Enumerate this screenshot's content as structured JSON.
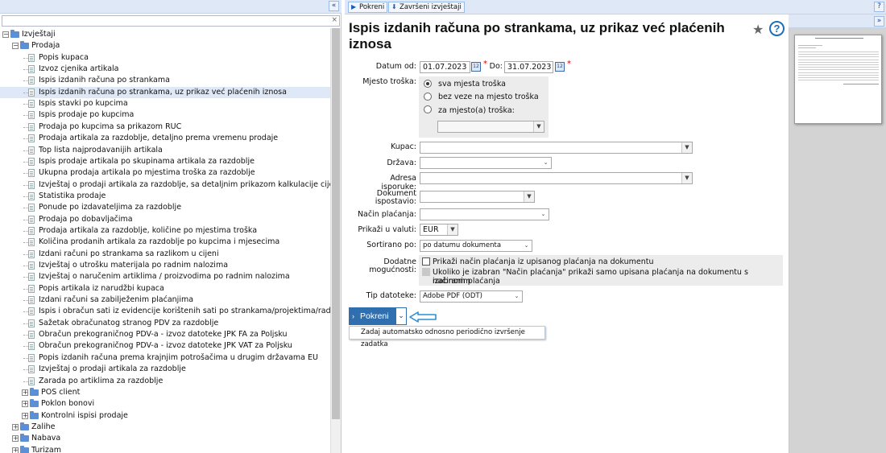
{
  "left_panel": {
    "collapse_label": "«",
    "search_placeholder": "",
    "clear_label": "×",
    "tree": [
      {
        "level": 0,
        "kind": "folder",
        "expanded": true,
        "label": "Izvještaji"
      },
      {
        "level": 1,
        "kind": "folder",
        "expanded": true,
        "label": "Prodaja"
      },
      {
        "level": 2,
        "kind": "doc",
        "label": "Popis kupaca"
      },
      {
        "level": 2,
        "kind": "doc",
        "label": "Izvoz cjenika artikala"
      },
      {
        "level": 2,
        "kind": "doc",
        "label": "Ispis izdanih računa po strankama"
      },
      {
        "level": 2,
        "kind": "doc",
        "label": "Ispis izdanih računa po strankama, uz prikaz već plaćenih iznosa",
        "selected": true
      },
      {
        "level": 2,
        "kind": "doc",
        "label": "Ispis stavki po kupcima"
      },
      {
        "level": 2,
        "kind": "doc",
        "label": "Ispis prodaje po kupcima"
      },
      {
        "level": 2,
        "kind": "doc",
        "label": "Prodaja po kupcima sa prikazom RUC"
      },
      {
        "level": 2,
        "kind": "doc",
        "label": "Prodaja artikala za razdoblje, detaljno prema vremenu prodaje"
      },
      {
        "level": 2,
        "kind": "doc",
        "label": "Top lista najprodavanijih artikala"
      },
      {
        "level": 2,
        "kind": "doc",
        "label": "Ispis prodaje artikala po skupinama artikala za razdoblje"
      },
      {
        "level": 2,
        "kind": "doc",
        "label": "Ukupna prodaja artikala po mjestima troška za razdoblje"
      },
      {
        "level": 2,
        "kind": "doc",
        "label": "Izvještaj o prodaji artikala za razdoblje, sa detaljnim prikazom kalkulacije cijena"
      },
      {
        "level": 2,
        "kind": "doc",
        "label": "Statistika prodaje"
      },
      {
        "level": 2,
        "kind": "doc",
        "label": "Ponude po izdavateljima za razdoblje"
      },
      {
        "level": 2,
        "kind": "doc",
        "label": "Prodaja po dobavljačima"
      },
      {
        "level": 2,
        "kind": "doc",
        "label": "Prodaja artikala za razdoblje, količine po mjestima troška"
      },
      {
        "level": 2,
        "kind": "doc",
        "label": "Količina prodanih artikala za razdoblje po kupcima i mjesecima"
      },
      {
        "level": 2,
        "kind": "doc",
        "label": "Izdani računi po strankama sa razlikom u cijeni"
      },
      {
        "level": 2,
        "kind": "doc",
        "label": "Izvještaj o utrošku materijala po radnim nalozima"
      },
      {
        "level": 2,
        "kind": "doc",
        "label": "Izvještaj o naručenim artiklima / proizvodima po radnim nalozima"
      },
      {
        "level": 2,
        "kind": "doc",
        "label": "Popis artikala iz narudžbi kupaca"
      },
      {
        "level": 2,
        "kind": "doc",
        "label": "Izdani računi sa zabilježenim plaćanjima"
      },
      {
        "level": 2,
        "kind": "doc",
        "label": "Ispis i obračun sati iz evidencije korištenih sati po strankama/projektima/radniku"
      },
      {
        "level": 2,
        "kind": "doc",
        "label": "Sažetak obračunatog stranog PDV za razdoblje"
      },
      {
        "level": 2,
        "kind": "doc",
        "label": "Obračun prekograničnog PDV-a - izvoz datoteke JPK FA za Poljsku"
      },
      {
        "level": 2,
        "kind": "doc",
        "label": "Obračun prekograničnog PDV-a - izvoz datoteke JPK VAT za Poljsku"
      },
      {
        "level": 2,
        "kind": "doc",
        "label": "Popis izdanih računa prema krajnjim potrošačima u drugim državama EU"
      },
      {
        "level": 2,
        "kind": "doc",
        "label": "Izvještaj o prodaji artikala za razdoblje"
      },
      {
        "level": 2,
        "kind": "doc",
        "label": "Zarada po artiklima za razdoblje"
      },
      {
        "level": 2,
        "kind": "folder",
        "expanded": false,
        "label": "POS client"
      },
      {
        "level": 2,
        "kind": "folder",
        "expanded": false,
        "label": "Poklon bonovi"
      },
      {
        "level": 2,
        "kind": "folder",
        "expanded": false,
        "label": "Kontrolni ispisi prodaje"
      },
      {
        "level": 1,
        "kind": "folder",
        "expanded": false,
        "label": "Zalihe"
      },
      {
        "level": 1,
        "kind": "folder",
        "expanded": false,
        "label": "Nabava"
      },
      {
        "level": 1,
        "kind": "folder",
        "expanded": false,
        "label": "Turizam"
      }
    ]
  },
  "toolbar": {
    "run_label": "Pokreni",
    "finished_label": "Završeni izvještaji",
    "help_label": "?"
  },
  "main": {
    "title": "Ispis izdanih računa po strankama, uz prikaz već plaćenih iznosa",
    "star_icon": "★",
    "help_icon": "?",
    "date_from_label": "Datum od:",
    "date_from_value": "01.07.2023",
    "date_to_label": "Do:",
    "date_to_value": "31.07.2023",
    "cost_center_label": "Mjesto troška:",
    "cost_options": [
      "sva mjesta troška",
      "bez veze na mjesto troška",
      "za mjesto(a) troška:"
    ],
    "cost_selected": 0,
    "customer_label": "Kupac:",
    "country_label": "Država:",
    "address_label": "Adresa isporuke:",
    "doc_issued_label_1": "Dokument",
    "doc_issued_label_2": "ispostavio:",
    "payment_label": "Način plaćanja:",
    "currency_label": "Prikaži u valuti:",
    "currency_value": "EUR",
    "sort_label": "Sortirano po:",
    "sort_value": "po datumu dokumenta",
    "extra_label_1": "Dodatne",
    "extra_label_2": "mogućnosti:",
    "extra_opt1": "Prikaži način plaćanja iz upisanog plaćanja na dokumentu",
    "extra_opt2_line1": "Ukoliko je izabran \"Način plaćanja\" prikaži samo upisana plaćanja na dokumentu s izabranim",
    "extra_opt2_line2": "načinom plaćanja",
    "filetype_label": "Tip datoteke:",
    "filetype_value": "Adobe PDF (ODT)",
    "run_button": "Pokreni",
    "menu_item": "Zadaj automatsko odnosno periodično izvršenje zadatka",
    "required_mark": "*"
  },
  "right_panel": {
    "collapse_label": "»"
  },
  "colors": {
    "accent": "#2f6fb0",
    "header_bg": "#dfe8f6",
    "preview_bg": "#d3d3d3",
    "required": "#dd0000"
  }
}
